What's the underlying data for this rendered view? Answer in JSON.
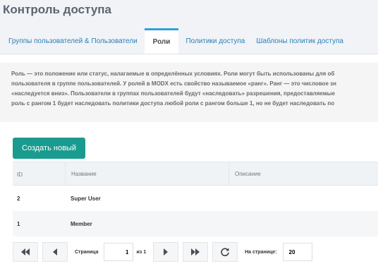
{
  "header": {
    "title": "Контроль доступа"
  },
  "tabs": [
    {
      "label": "Группы пользователей & Пользователи",
      "active": false
    },
    {
      "label": "Роли",
      "active": true
    },
    {
      "label": "Политики доступа",
      "active": false
    },
    {
      "label": "Шаблоны политик доступа",
      "active": false
    }
  ],
  "intro": {
    "lines": [
      "Роль — это положение или статус, налагаемые в определённых условиях. Роли могут быть использованы для об",
      "пользователя в группе пользователей. У ролей в MODX есть свойство называемое «ранг». Ранг — это числовое зн",
      "«наследуется вниз». Пользователи в группах пользователей будут «наследовать» разрешения, предоставляемые",
      "роль с рангом 1 будет наследовать политики доступа любой роли с рангом больше 1, но не будет наследовать по"
    ]
  },
  "toolbar": {
    "create_label": "Создать новый"
  },
  "grid": {
    "columns": {
      "id": "ID",
      "name": "Название",
      "description": "Описание"
    },
    "rows": [
      {
        "id": "2",
        "name": "Super User",
        "description": ""
      },
      {
        "id": "1",
        "name": "Member",
        "description": ""
      }
    ]
  },
  "pager": {
    "page_label": "Страница",
    "page_value": "1",
    "of_label": "из 1",
    "per_page_label": "На странице:",
    "per_page_value": "20"
  },
  "colors": {
    "accent": "#1a9b8f",
    "tab_active_border": "#31a0d6",
    "link": "#2a7fb8"
  }
}
